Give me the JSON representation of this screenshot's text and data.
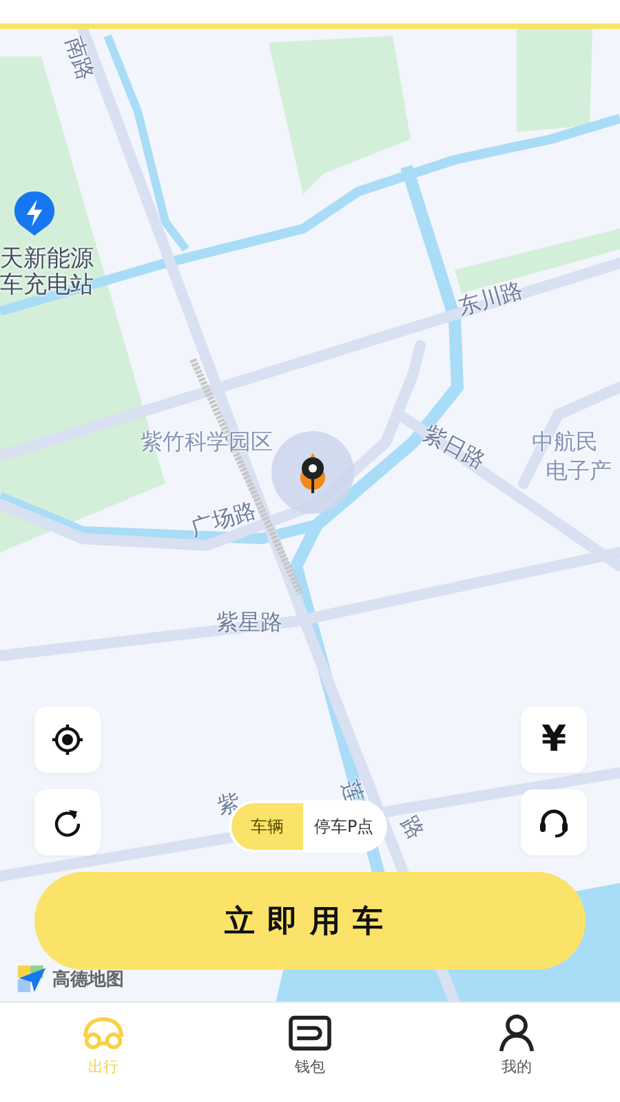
{
  "map": {
    "labels": [
      {
        "text": "南路",
        "kind": "road"
      },
      {
        "text": "天新能源",
        "kind": "poi"
      },
      {
        "text": "车充电站",
        "kind": "poi"
      },
      {
        "text": "东川路",
        "kind": "road"
      },
      {
        "text": "紫竹科学园区",
        "kind": "area"
      },
      {
        "text": "紫日路",
        "kind": "road"
      },
      {
        "text": "中航民",
        "kind": "area"
      },
      {
        "text": "电子产",
        "kind": "area"
      },
      {
        "text": "广场路",
        "kind": "road"
      },
      {
        "text": "紫星路",
        "kind": "road"
      },
      {
        "text": "紫",
        "kind": "road"
      },
      {
        "text": "莲",
        "kind": "road"
      },
      {
        "text": "路",
        "kind": "road"
      }
    ],
    "logo": "高德地图"
  },
  "left_buttons": [
    {
      "kind": "locate"
    },
    {
      "kind": "refresh"
    }
  ],
  "right_buttons": [
    {
      "kind": "text",
      "text": "¥"
    },
    {
      "kind": "support"
    }
  ],
  "mode_toggle": [
    {
      "label": "车辆",
      "selected": true
    },
    {
      "label": "停车P点",
      "selected": false
    }
  ],
  "primary_button": "立即用车",
  "tabs": [
    {
      "label": "出行",
      "selected": true,
      "kind": "car"
    },
    {
      "label": "钱包",
      "selected": false,
      "kind": "wallet"
    },
    {
      "label": "我的",
      "selected": false,
      "kind": "person"
    }
  ]
}
